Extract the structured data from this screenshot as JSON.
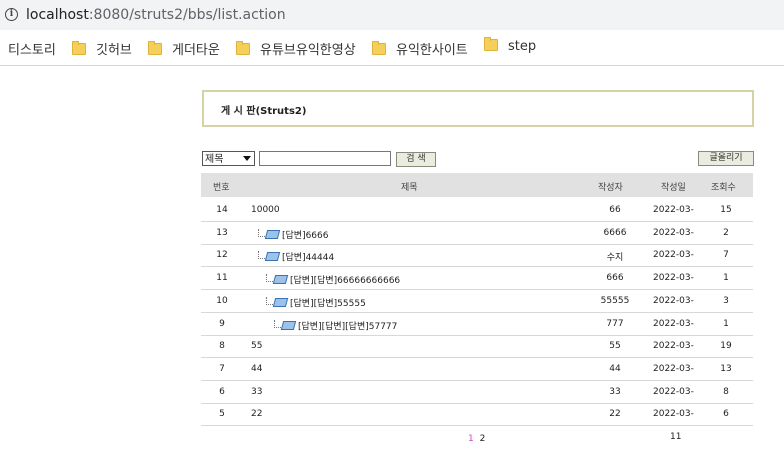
{
  "browser": {
    "url_host": "localhost",
    "url_rest": ":8080/struts2/bbs/list.action"
  },
  "bookmarks": [
    {
      "label": "티스토리",
      "folder": false
    },
    {
      "label": "깃허브",
      "folder": true
    },
    {
      "label": "게더타운",
      "folder": true
    },
    {
      "label": "유튜브유익한영상",
      "folder": true
    },
    {
      "label": "유익한사이트",
      "folder": true
    },
    {
      "label": "step",
      "folder": true
    }
  ],
  "board": {
    "title": "게 시 판(Struts2)"
  },
  "search": {
    "field_selected": "제목",
    "query": "",
    "search_button": "검 색",
    "write_button": "글올리기"
  },
  "table": {
    "headers": {
      "num": "번호",
      "title": "제목",
      "writer": "작성자",
      "date": "작성일",
      "hits": "조회수"
    },
    "rows": [
      {
        "num": "14",
        "depth": 0,
        "title": "10000",
        "writer": "66",
        "date": "2022-03-",
        "hits": "15"
      },
      {
        "num": "13",
        "depth": 1,
        "title": "[답변]6666",
        "writer": "6666",
        "date": "2022-03-",
        "hits": "2"
      },
      {
        "num": "12",
        "depth": 1,
        "title": "[답변]44444",
        "writer": "수지",
        "date": "2022-03-",
        "hits": "7"
      },
      {
        "num": "11",
        "depth": 2,
        "title": "[답변][답변]66666666666",
        "writer": "666",
        "date": "2022-03-",
        "hits": "1"
      },
      {
        "num": "10",
        "depth": 2,
        "title": "[답변][답변]55555",
        "writer": "55555",
        "date": "2022-03-",
        "hits": "3"
      },
      {
        "num": "9",
        "depth": 3,
        "title": "[답변][답변][답변]57777",
        "writer": "777",
        "date": "2022-03-",
        "hits": "1"
      },
      {
        "num": "8",
        "depth": 0,
        "title": "55",
        "writer": "55",
        "date": "2022-03-",
        "hits": "19"
      },
      {
        "num": "7",
        "depth": 0,
        "title": "44",
        "writer": "44",
        "date": "2022-03-",
        "hits": "13"
      },
      {
        "num": "6",
        "depth": 0,
        "title": "33",
        "writer": "33",
        "date": "2022-03-",
        "hits": "8"
      },
      {
        "num": "5",
        "depth": 0,
        "title": "22",
        "writer": "22",
        "date": "2022-03-",
        "hits": "6"
      }
    ],
    "overflow_text": "11"
  },
  "pagination": {
    "pages": [
      "1",
      "2"
    ],
    "current": "1"
  }
}
